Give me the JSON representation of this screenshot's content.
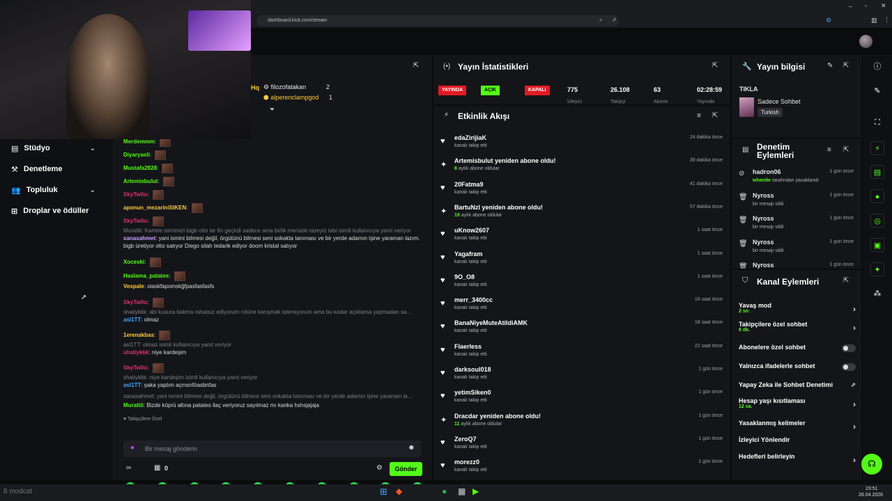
{
  "browser": {
    "url": "dashboard.kick.com/stream"
  },
  "nav": {
    "items": [
      {
        "label": "Stüdyo",
        "chevron": true
      },
      {
        "label": "Denetleme",
        "chevron": false
      },
      {
        "label": "Topluluk",
        "chevron": true
      },
      {
        "label": "Droplar ve ödüller",
        "chevron": false
      }
    ]
  },
  "chat": {
    "viewers": [
      {
        "name": "filozofatakan",
        "count": "2"
      },
      {
        "name": "alperenclampgod",
        "count": "1"
      }
    ],
    "hq_label": "Hq",
    "lines": [
      {
        "user": "Merdemmm",
        "text": "",
        "color": "#53fc18",
        "emote": true
      },
      {
        "user": "Diyaryasli",
        "text": "",
        "color": "#53fc18",
        "emote": true
      },
      {
        "user": "Mustafa2828",
        "text": "",
        "color": "#53fc18",
        "emote": true
      },
      {
        "user": "Artemisbulut",
        "text": "",
        "color": "#53fc18",
        "emote": true
      },
      {
        "user": "SkyTw0o",
        "text": "",
        "color": "#e0306e",
        "emote": true
      },
      {
        "user": "aponun_mezariniSIKEN",
        "text": "",
        "color": "#ffc93c",
        "emote": true
      },
      {
        "user": "SkyTw0o",
        "text": "",
        "color": "#e0306e",
        "emote": true
      },
      {
        "reply": "Murattii: Kartele isimimizi bigb otto lar fin geçirdi sadece ama birlik menüde tazeyiz tabi isimli kullanıcıya yanıt veriyor"
      },
      {
        "user": "xanaxahmet",
        "text": "yani ismini bilmesi değil, örgütünü bilmesi seni sokakta tanıması ve bir yerde adamın işine yaraman lazım. bigb üretiyor otto satıyor Diego silah tedarik ediyor doom kristal satıyor",
        "color": "#c9a0ff"
      },
      {
        "user": "Xoceski",
        "text": "",
        "color": "#53fc18",
        "emote": true
      },
      {
        "user": "Haslama_patates",
        "text": "",
        "color": "#53fc18",
        "emote": true
      },
      {
        "user": "Vespale",
        "text": "oiaskfapomskğfpasfasfasfs",
        "color": "#ffc93c"
      },
      {
        "user": "SkyTw0o",
        "text": "",
        "color": "#e0306e",
        "emote": true
      },
      {
        "reply": "shatiykkk: abi kusura bakma rahatsız ediyorum rolüne karışmak istemiyorum ama bu kadar açıklama yapmadan sa..."
      },
      {
        "user": "asl1TT",
        "text": "olmaz",
        "color": "#3ea6ff"
      },
      {
        "user": "1erenakbas",
        "text": "",
        "color": "#ffc93c",
        "emote": true
      },
      {
        "reply": "asl1TT: olmaz isimli kullanıcıya yanıt veriyor"
      },
      {
        "user": "shatiykkk",
        "text": "niye kardeşim",
        "color": "#e0306e"
      },
      {
        "user": "SkyTw0o",
        "text": "",
        "color": "#e0306e",
        "emote": true
      },
      {
        "reply": "shatiykkk: niye kardeşim isimli kullanıcıya yanıt veriyor"
      },
      {
        "user": "asl1TT",
        "text": "şaka yaptım açmsnföasbnfas",
        "color": "#3ea6ff"
      },
      {
        "reply": "xanaxahmet: yani ismini bilmesi değil, örgütünü bilmesi seni sokakta tanıması ve bir yerde adamın işine yaraman la..."
      },
      {
        "user": "Murattii",
        "text": "Bizde köprü altına patates ilaç veriyoruz sayılmaz mı kanka hshsjajaja",
        "color": "#53fc18"
      }
    ],
    "followers_only": "Takipçilere Özel",
    "input_placeholder": "Bir mesaj gönderin",
    "send_label": "Gönder",
    "points": "0"
  },
  "stats": {
    "title": "Yayın İstatistikleri",
    "badges": [
      {
        "label": "YAYINDA",
        "bg": "#e01b24",
        "fg": "#fff"
      },
      {
        "label": "AÇIK",
        "bg": "#53fc18",
        "fg": "#000"
      },
      {
        "label": "KAPALI",
        "bg": "#e01b24",
        "fg": "#fff"
      }
    ],
    "values": [
      {
        "num": "775",
        "label": "İzleyici"
      },
      {
        "num": "26.108",
        "label": "Takipçi"
      },
      {
        "num": "63",
        "label": "Abone"
      },
      {
        "num": "02:28:59",
        "label": "Yayında"
      }
    ]
  },
  "events": {
    "title": "Etkinlik Akışı",
    "items": [
      {
        "icon": "heart",
        "name": "edaZirijiaK",
        "sub": "kanalı takip etti",
        "time": "24 dakika önce"
      },
      {
        "icon": "sparkle",
        "name": "Artemisbulut yeniden abone oldu!",
        "sub": "aylık abone oldular",
        "months": "8",
        "time": "39 dakika önce"
      },
      {
        "icon": "heart",
        "name": "20Fatma9",
        "sub": "kanalı takip etti",
        "time": "41 dakika önce"
      },
      {
        "icon": "sparkle",
        "name": "BartuNzl yeniden abone oldu!",
        "sub": "aylık abone oldular",
        "months": "19",
        "time": "57 dakika önce"
      },
      {
        "icon": "heart",
        "name": "uKnow2607",
        "sub": "kanalı takip etti",
        "time": "1 saat önce"
      },
      {
        "icon": "heart",
        "name": "Yagafram",
        "sub": "kanalı takip etti",
        "time": "1 saat önce"
      },
      {
        "icon": "heart",
        "name": "9O_O8",
        "sub": "kanalı takip etti",
        "time": "1 saat önce"
      },
      {
        "icon": "heart",
        "name": "merr_3400cc",
        "sub": "kanalı takip etti",
        "time": "16 saat önce"
      },
      {
        "icon": "heart",
        "name": "BanaNiyeMuteAtildiAMK",
        "sub": "kanalı takip etti",
        "time": "18 saat önce"
      },
      {
        "icon": "heart",
        "name": "Flaerless",
        "sub": "kanalı takip etti",
        "time": "22 saat önce"
      },
      {
        "icon": "heart",
        "name": "darksoul018",
        "sub": "kanalı takip etti",
        "time": "1 gün önce"
      },
      {
        "icon": "heart",
        "name": "yetimSiken0",
        "sub": "kanalı takip etti",
        "time": "1 gün önce"
      },
      {
        "icon": "sparkle",
        "name": "Dracdar yeniden abone oldu!",
        "sub": "aylık abone oldular",
        "months": "11",
        "time": "1 gün önce"
      },
      {
        "icon": "heart",
        "name": "ZeroQ7",
        "sub": "kanalı takip etti",
        "time": "1 gün önce"
      },
      {
        "icon": "heart",
        "name": "morezz0",
        "sub": "kanalı takip etti",
        "time": "1 gün önce"
      }
    ]
  },
  "info": {
    "title": "Yayın bilgisi",
    "stream_title": "TIKLA",
    "category": "Sadece Sohbet",
    "language": "Turkish"
  },
  "mod": {
    "title": "Denetim Eylemleri",
    "items": [
      {
        "icon": "ban",
        "user": "hadron06",
        "desc_user": "whenite",
        "desc": "tarafından yasaklandı",
        "time": "1 gün önce"
      },
      {
        "icon": "trash",
        "user": "Nyross",
        "desc": "bir mesajı sildi",
        "time": "1 gün önce"
      },
      {
        "icon": "trash",
        "user": "Nyross",
        "desc": "bir mesajı sildi",
        "time": "1 gün önce"
      },
      {
        "icon": "trash",
        "user": "Nyross",
        "desc": "bir mesajı sildi",
        "time": "1 gün önce"
      },
      {
        "icon": "trash",
        "user": "Nyross",
        "desc": "",
        "time": "1 gün önce"
      }
    ]
  },
  "channel": {
    "title": "Kanal Eylemleri",
    "items": [
      {
        "label": "Yavaş mod",
        "sub": "2 sn.",
        "control": "chevron"
      },
      {
        "label": "Takipçilere özel sohbet",
        "sub": "6 dk.",
        "control": "chevron"
      },
      {
        "label": "Abonelere özel sohbet",
        "sub": "",
        "control": "toggle"
      },
      {
        "label": "Yalnızca ifadelerle sohbet",
        "sub": "",
        "control": "toggle"
      },
      {
        "label": "Yapay Zeka ile Sohbet Denetimi",
        "sub": "",
        "control": "external"
      },
      {
        "label": "Hesap yaşı kısıtlaması",
        "sub": "12 sa.",
        "control": "chevron"
      },
      {
        "label": "Yasaklanmış kelimeler",
        "sub": "",
        "control": "chevron"
      },
      {
        "label": "İzleyici Yönlendir",
        "sub": "",
        "control": "none"
      },
      {
        "label": "Hedefleri belirleyin",
        "sub": "",
        "control": "chevron"
      }
    ]
  },
  "taskbar": {
    "time": "23:51",
    "date": "26.04.2026",
    "left_text": "8 modcat"
  },
  "colors": {
    "accent": "#53fc18",
    "live": "#e01b24",
    "panel": "#141519",
    "bg": "#0b0c0e"
  }
}
